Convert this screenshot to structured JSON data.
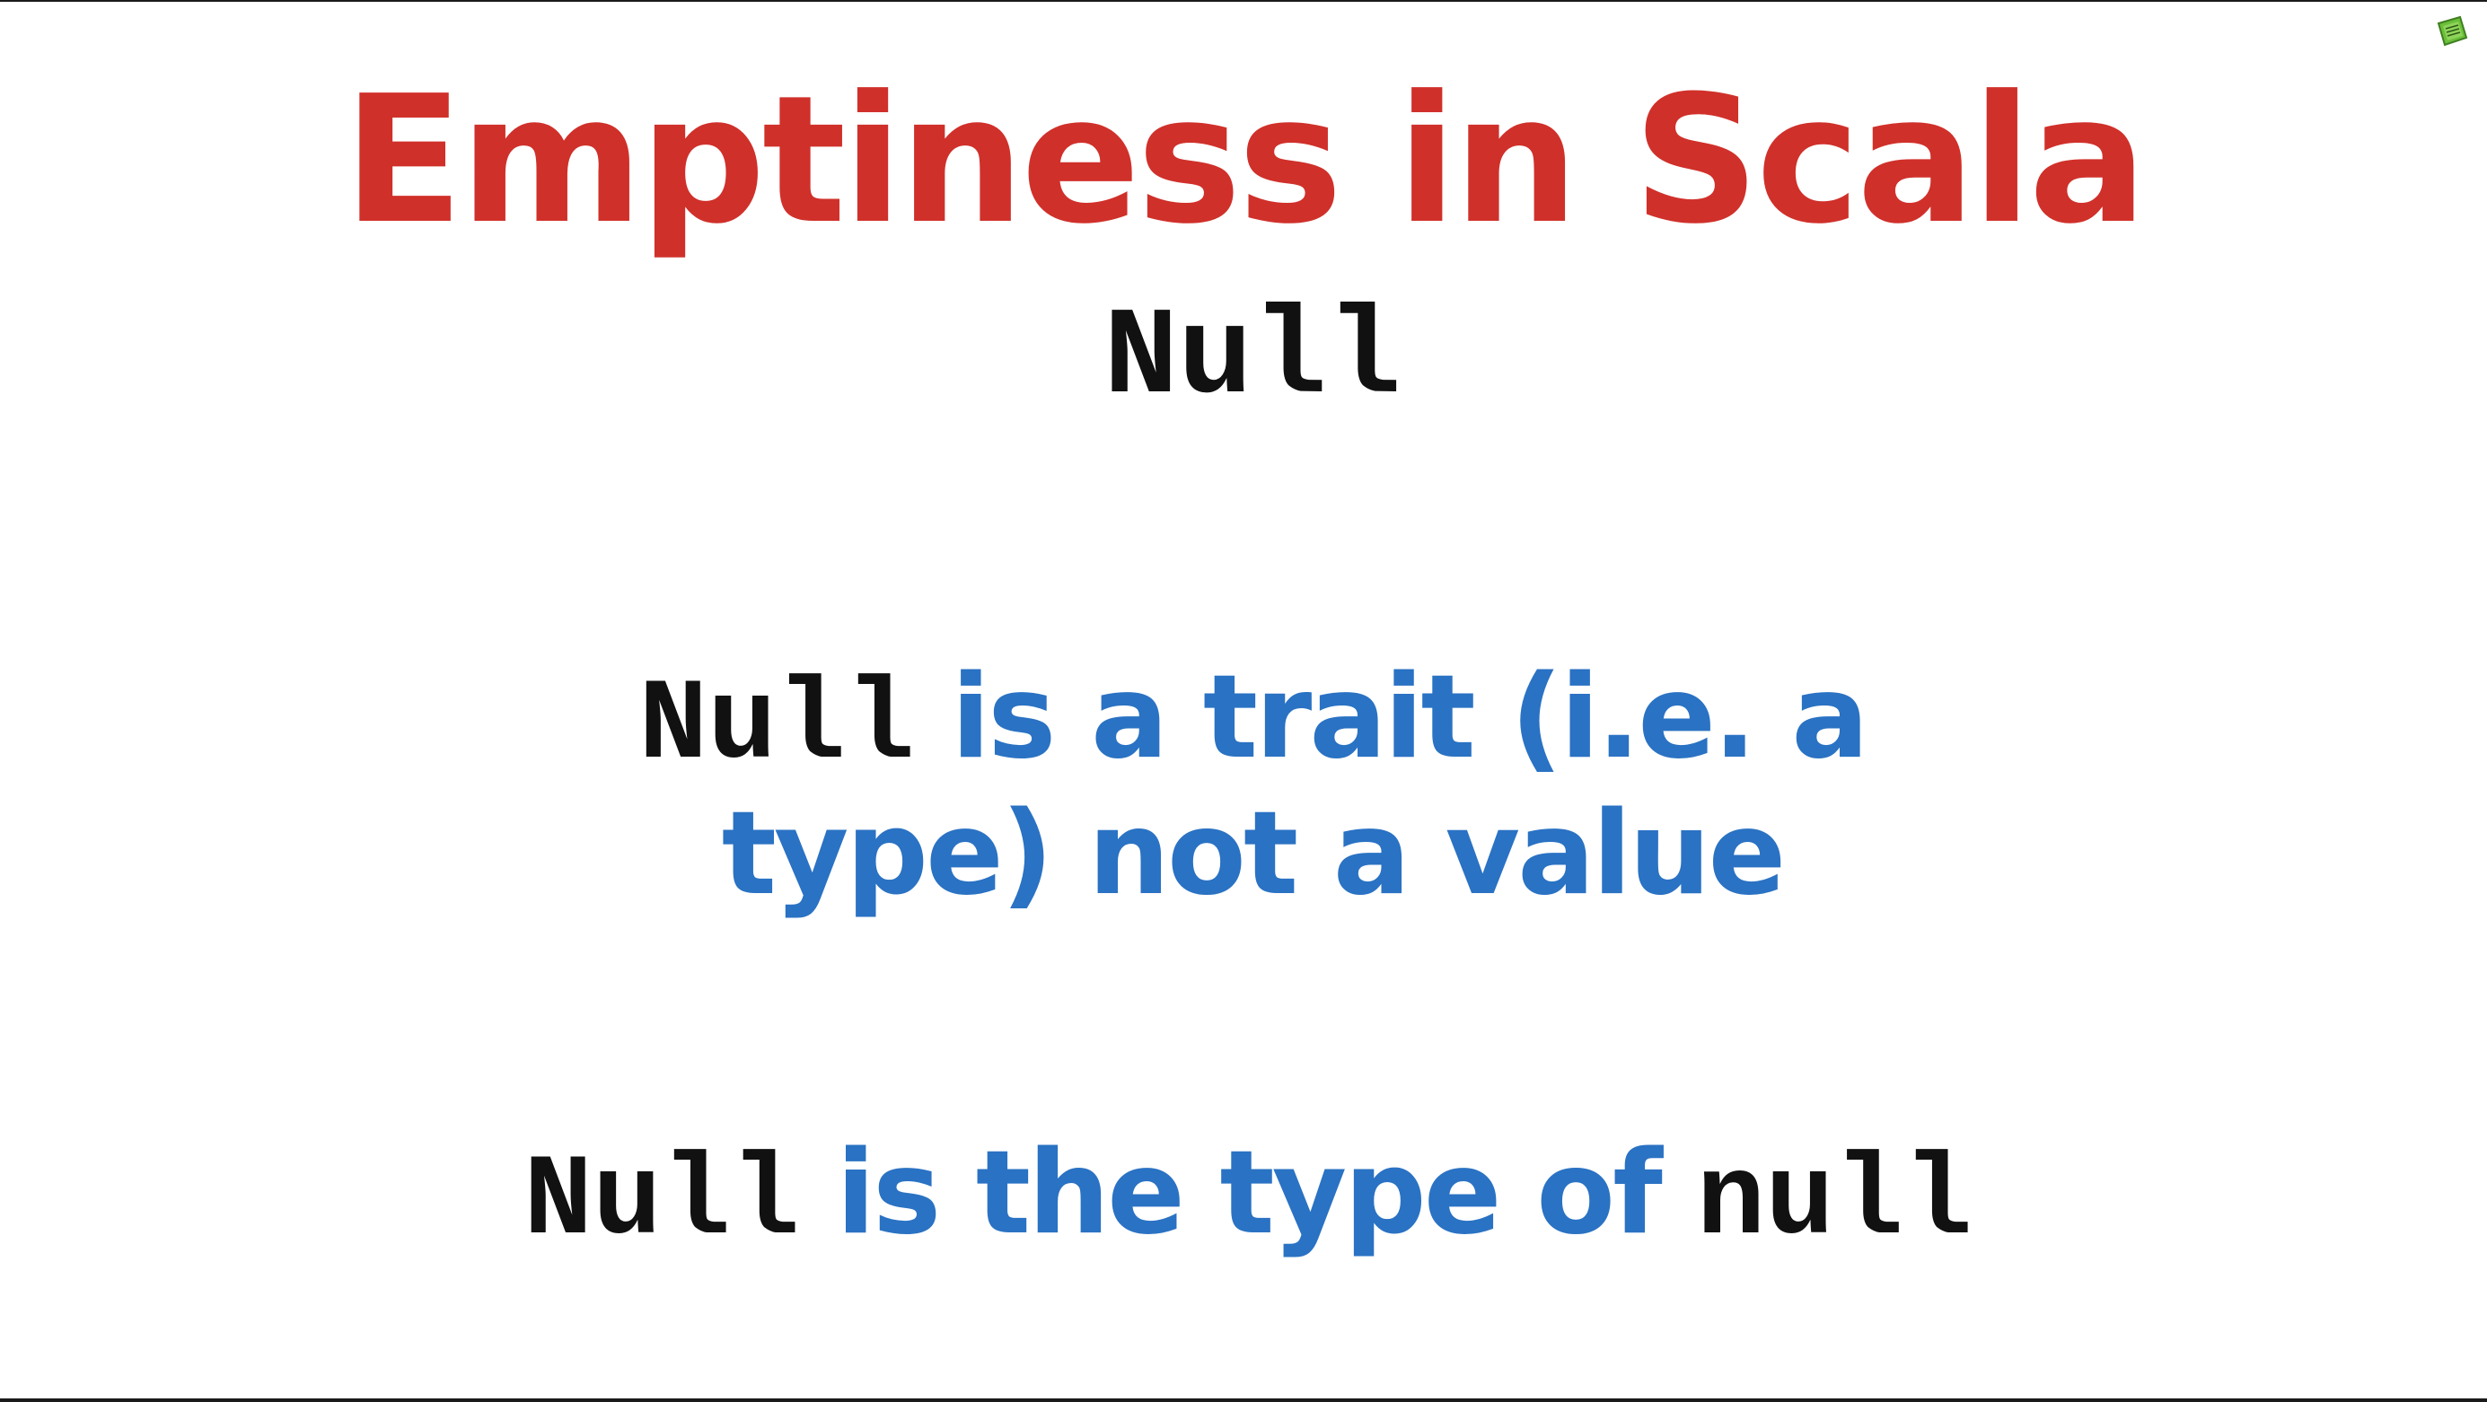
{
  "slide": {
    "title": "Emptiness in Scala",
    "subtitle": "Null",
    "statement1": {
      "code": "Null",
      "text_line1": "is a trait (i.e. a",
      "text_line2": "type) not a value"
    },
    "statement2": {
      "code1": "Null",
      "text": "is the type of",
      "code2": "null"
    }
  },
  "colors": {
    "title": "#d0302a",
    "code": "#111111",
    "text": "#2a72c3",
    "logo": "#6bbf3a"
  },
  "icons": {
    "logo": "green-box-logo-icon"
  }
}
